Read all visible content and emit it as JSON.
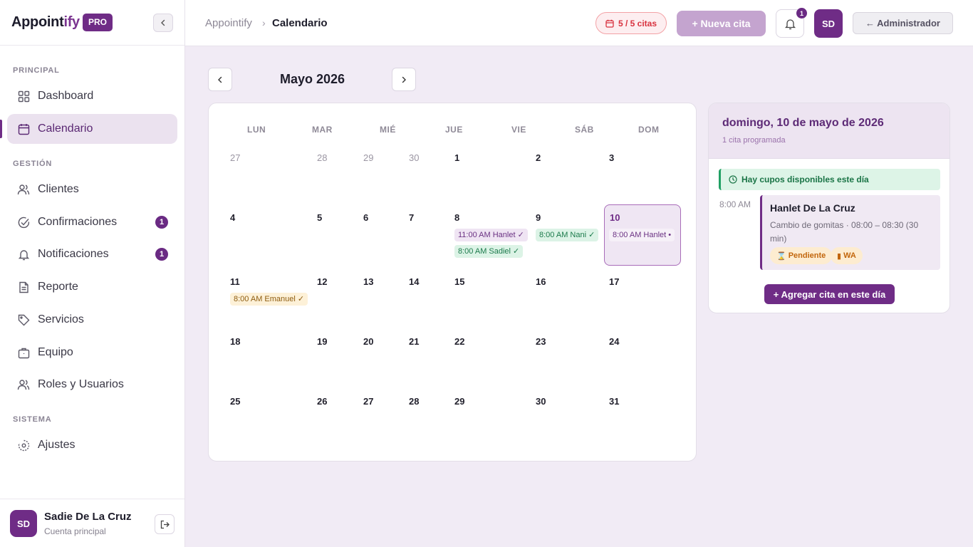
{
  "brand": {
    "name_main": "Appoint",
    "name_accent": "ify",
    "badge": "PRO"
  },
  "sidebar": {
    "sections": {
      "principal": "PRINCIPAL",
      "gestion": "GESTIÓN",
      "sistema": "SISTEMA"
    },
    "items": [
      {
        "label": "Dashboard",
        "icon": "grid-icon"
      },
      {
        "label": "Calendario",
        "icon": "calendar-icon",
        "active": true
      },
      {
        "label": "Clientes",
        "icon": "users-icon"
      },
      {
        "label": "Confirmaciones",
        "icon": "check-circle-icon",
        "count": "1"
      },
      {
        "label": "Notificaciones",
        "icon": "bell-icon",
        "count": "1"
      },
      {
        "label": "Reporte",
        "icon": "document-icon"
      },
      {
        "label": "Servicios",
        "icon": "tag-icon"
      },
      {
        "label": "Equipo",
        "icon": "briefcase-icon"
      },
      {
        "label": "Roles y Usuarios",
        "icon": "users-icon"
      },
      {
        "label": "Ajustes",
        "icon": "gear-icon"
      }
    ],
    "user": {
      "initials": "SD",
      "name": "Sadie De La Cruz",
      "subtitle": "Cuenta principal"
    }
  },
  "header": {
    "breadcrumb_root": "Appointify",
    "breadcrumb_sep": "›",
    "breadcrumb_current": "Calendario",
    "quota": "5 / 5 citas",
    "new_button": "+  Nueva cita",
    "bell_count": "1",
    "avatar_initials": "SD",
    "admin_button": "← Administrador"
  },
  "calendar": {
    "month_title": "Mayo 2026",
    "weekdays": [
      "LUN",
      "MAR",
      "MIÉ",
      "JUE",
      "VIE",
      "SÁB",
      "DOM"
    ],
    "weeks": [
      [
        "27",
        "28",
        "29",
        "30",
        "1",
        "2",
        "3"
      ],
      [
        "4",
        "5",
        "6",
        "7",
        "8",
        "9",
        "10"
      ],
      [
        "11",
        "12",
        "13",
        "14",
        "15",
        "16",
        "17"
      ],
      [
        "18",
        "19",
        "20",
        "21",
        "22",
        "23",
        "24"
      ],
      [
        "25",
        "26",
        "27",
        "28",
        "29",
        "30",
        "31"
      ]
    ],
    "events": {
      "may8_a": "11:00 AM Hanlet ✓",
      "may8_b": "8:00 AM Sadiel ✓",
      "may9": "8:00 AM Nani ✓",
      "may10": "8:00 AM Hanlet •",
      "may11": "8:00 AM Emanuel ✓"
    }
  },
  "day_panel": {
    "title": "domingo, 10 de mayo de 2026",
    "subtitle": "1 cita programada",
    "availability": "Hay cupos disponibles este día",
    "appointment": {
      "time": "8:00 AM",
      "client": "Hanlet De La Cruz",
      "description": "Cambio de gomitas · 08:00 – 08:30 (30 min)",
      "status": "Pendiente",
      "channel": "WA"
    },
    "add_button": "+ Agregar cita en este día"
  },
  "colors": {
    "accent": "#6f2c86",
    "accent_light": "#ebe2ef",
    "quota_red": "#d8323f",
    "success_green": "#21a064",
    "pending_orange": "#c2660c"
  }
}
